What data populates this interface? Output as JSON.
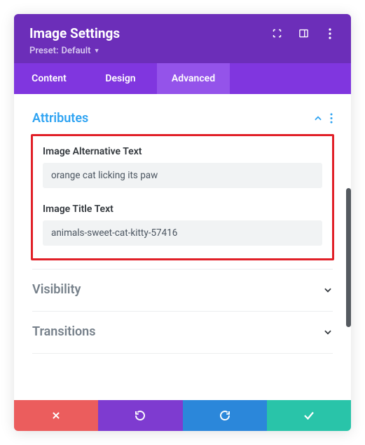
{
  "header": {
    "title": "Image Settings",
    "preset_prefix": "Preset:",
    "preset_value": "Default"
  },
  "tabs": {
    "content": "Content",
    "design": "Design",
    "advanced": "Advanced"
  },
  "sections": {
    "attributes": {
      "title": "Attributes",
      "alt_label": "Image Alternative Text",
      "alt_value": "orange cat licking its paw",
      "title_label": "Image Title Text",
      "title_value": "animals-sweet-cat-kitty-57416"
    },
    "visibility": {
      "title": "Visibility"
    },
    "transitions": {
      "title": "Transitions"
    }
  },
  "colors": {
    "accent": "#2ea3f2",
    "header": "#6c2eb9",
    "tabbar": "#8036df",
    "tab_active": "#9453ea",
    "highlight": "#e12028"
  }
}
